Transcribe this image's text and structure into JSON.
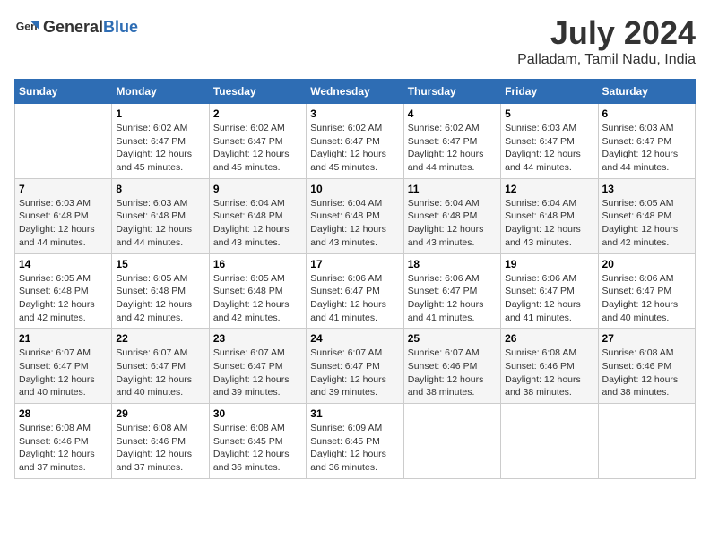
{
  "header": {
    "logo_general": "General",
    "logo_blue": "Blue",
    "title": "July 2024",
    "location": "Palladam, Tamil Nadu, India"
  },
  "weekdays": [
    "Sunday",
    "Monday",
    "Tuesday",
    "Wednesday",
    "Thursday",
    "Friday",
    "Saturday"
  ],
  "weeks": [
    [
      {
        "day": "",
        "info": ""
      },
      {
        "day": "1",
        "info": "Sunrise: 6:02 AM\nSunset: 6:47 PM\nDaylight: 12 hours\nand 45 minutes."
      },
      {
        "day": "2",
        "info": "Sunrise: 6:02 AM\nSunset: 6:47 PM\nDaylight: 12 hours\nand 45 minutes."
      },
      {
        "day": "3",
        "info": "Sunrise: 6:02 AM\nSunset: 6:47 PM\nDaylight: 12 hours\nand 45 minutes."
      },
      {
        "day": "4",
        "info": "Sunrise: 6:02 AM\nSunset: 6:47 PM\nDaylight: 12 hours\nand 44 minutes."
      },
      {
        "day": "5",
        "info": "Sunrise: 6:03 AM\nSunset: 6:47 PM\nDaylight: 12 hours\nand 44 minutes."
      },
      {
        "day": "6",
        "info": "Sunrise: 6:03 AM\nSunset: 6:47 PM\nDaylight: 12 hours\nand 44 minutes."
      }
    ],
    [
      {
        "day": "7",
        "info": "Sunrise: 6:03 AM\nSunset: 6:48 PM\nDaylight: 12 hours\nand 44 minutes."
      },
      {
        "day": "8",
        "info": "Sunrise: 6:03 AM\nSunset: 6:48 PM\nDaylight: 12 hours\nand 44 minutes."
      },
      {
        "day": "9",
        "info": "Sunrise: 6:04 AM\nSunset: 6:48 PM\nDaylight: 12 hours\nand 43 minutes."
      },
      {
        "day": "10",
        "info": "Sunrise: 6:04 AM\nSunset: 6:48 PM\nDaylight: 12 hours\nand 43 minutes."
      },
      {
        "day": "11",
        "info": "Sunrise: 6:04 AM\nSunset: 6:48 PM\nDaylight: 12 hours\nand 43 minutes."
      },
      {
        "day": "12",
        "info": "Sunrise: 6:04 AM\nSunset: 6:48 PM\nDaylight: 12 hours\nand 43 minutes."
      },
      {
        "day": "13",
        "info": "Sunrise: 6:05 AM\nSunset: 6:48 PM\nDaylight: 12 hours\nand 42 minutes."
      }
    ],
    [
      {
        "day": "14",
        "info": "Sunrise: 6:05 AM\nSunset: 6:48 PM\nDaylight: 12 hours\nand 42 minutes."
      },
      {
        "day": "15",
        "info": "Sunrise: 6:05 AM\nSunset: 6:48 PM\nDaylight: 12 hours\nand 42 minutes."
      },
      {
        "day": "16",
        "info": "Sunrise: 6:05 AM\nSunset: 6:48 PM\nDaylight: 12 hours\nand 42 minutes."
      },
      {
        "day": "17",
        "info": "Sunrise: 6:06 AM\nSunset: 6:47 PM\nDaylight: 12 hours\nand 41 minutes."
      },
      {
        "day": "18",
        "info": "Sunrise: 6:06 AM\nSunset: 6:47 PM\nDaylight: 12 hours\nand 41 minutes."
      },
      {
        "day": "19",
        "info": "Sunrise: 6:06 AM\nSunset: 6:47 PM\nDaylight: 12 hours\nand 41 minutes."
      },
      {
        "day": "20",
        "info": "Sunrise: 6:06 AM\nSunset: 6:47 PM\nDaylight: 12 hours\nand 40 minutes."
      }
    ],
    [
      {
        "day": "21",
        "info": "Sunrise: 6:07 AM\nSunset: 6:47 PM\nDaylight: 12 hours\nand 40 minutes."
      },
      {
        "day": "22",
        "info": "Sunrise: 6:07 AM\nSunset: 6:47 PM\nDaylight: 12 hours\nand 40 minutes."
      },
      {
        "day": "23",
        "info": "Sunrise: 6:07 AM\nSunset: 6:47 PM\nDaylight: 12 hours\nand 39 minutes."
      },
      {
        "day": "24",
        "info": "Sunrise: 6:07 AM\nSunset: 6:47 PM\nDaylight: 12 hours\nand 39 minutes."
      },
      {
        "day": "25",
        "info": "Sunrise: 6:07 AM\nSunset: 6:46 PM\nDaylight: 12 hours\nand 38 minutes."
      },
      {
        "day": "26",
        "info": "Sunrise: 6:08 AM\nSunset: 6:46 PM\nDaylight: 12 hours\nand 38 minutes."
      },
      {
        "day": "27",
        "info": "Sunrise: 6:08 AM\nSunset: 6:46 PM\nDaylight: 12 hours\nand 38 minutes."
      }
    ],
    [
      {
        "day": "28",
        "info": "Sunrise: 6:08 AM\nSunset: 6:46 PM\nDaylight: 12 hours\nand 37 minutes."
      },
      {
        "day": "29",
        "info": "Sunrise: 6:08 AM\nSunset: 6:46 PM\nDaylight: 12 hours\nand 37 minutes."
      },
      {
        "day": "30",
        "info": "Sunrise: 6:08 AM\nSunset: 6:45 PM\nDaylight: 12 hours\nand 36 minutes."
      },
      {
        "day": "31",
        "info": "Sunrise: 6:09 AM\nSunset: 6:45 PM\nDaylight: 12 hours\nand 36 minutes."
      },
      {
        "day": "",
        "info": ""
      },
      {
        "day": "",
        "info": ""
      },
      {
        "day": "",
        "info": ""
      }
    ]
  ]
}
